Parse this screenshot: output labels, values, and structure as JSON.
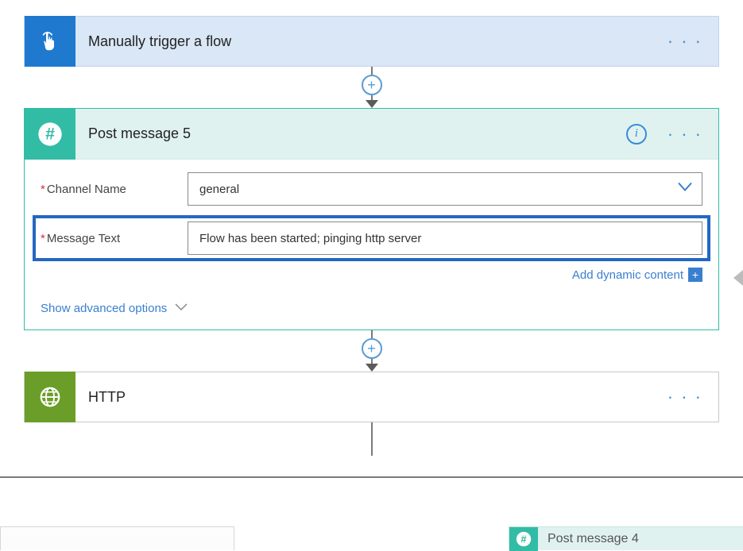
{
  "trigger": {
    "title": "Manually trigger a flow"
  },
  "post": {
    "title": "Post message 5",
    "channel_label": "Channel Name",
    "channel_value": "general",
    "message_label": "Message Text",
    "message_value": "Flow has been started; pinging http server",
    "dyn_link": "Add dynamic content",
    "adv_text": "Show advanced options"
  },
  "http": {
    "title": "HTTP"
  },
  "bottom_right": {
    "title": "Post message 4"
  },
  "glyphs": {
    "more": "· · ·",
    "plus": "+",
    "info": "i"
  }
}
